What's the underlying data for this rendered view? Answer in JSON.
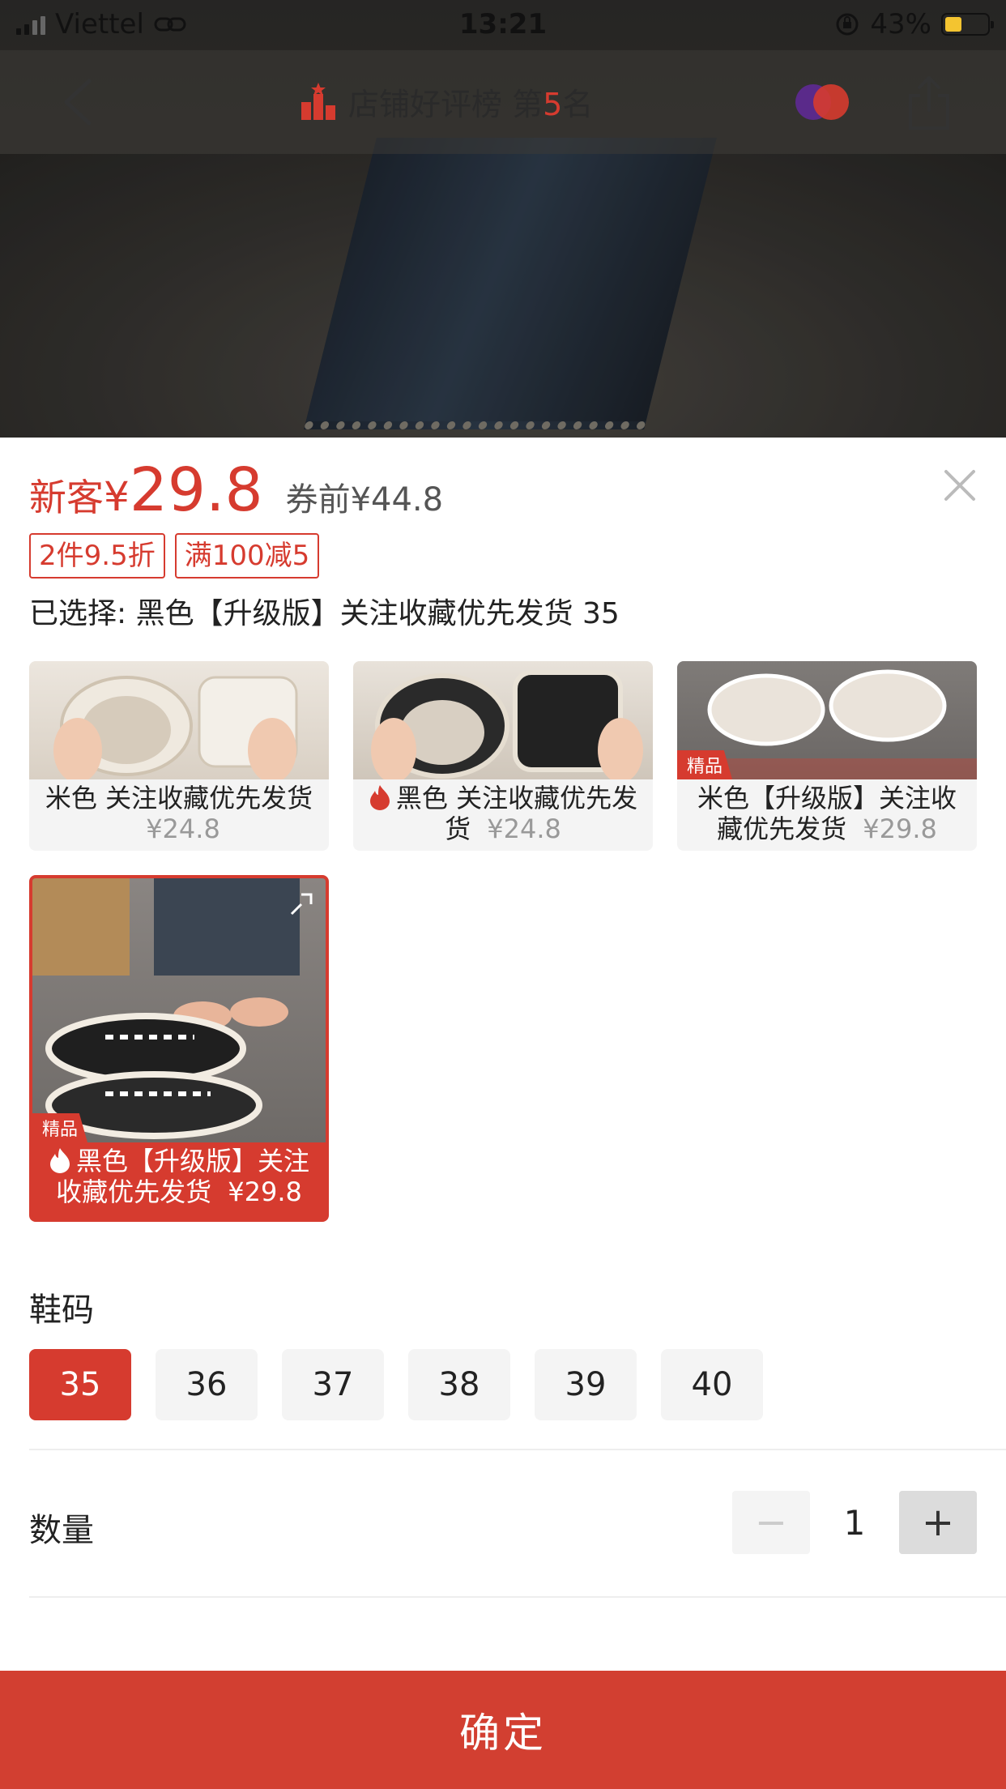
{
  "status_bar": {
    "carrier": "Viettel",
    "time": "13:21",
    "battery": "43%"
  },
  "nav": {
    "title_prefix": "店铺好评榜 第",
    "rank": "5",
    "title_suffix": "名"
  },
  "price": {
    "new_customer": "新客",
    "currency": "¥",
    "value": "29.8",
    "before_coupon": "券前¥44.8"
  },
  "promos": [
    "2件9.5折",
    "满100减5"
  ],
  "selected_text": "已选择: 黑色【升级版】关注收藏优先发货 35",
  "variants": [
    {
      "name": "米色 关注收藏优先发货",
      "price": "¥24.8",
      "hot": false,
      "badge": ""
    },
    {
      "name": "黑色 关注收藏优先发货",
      "price": "¥24.8",
      "hot": true,
      "badge": ""
    },
    {
      "name": "米色【升级版】关注收藏优先发货",
      "price": "¥29.8",
      "hot": false,
      "badge": "精品"
    },
    {
      "name": "黑色【升级版】关注收藏优先发货",
      "price": "¥29.8",
      "hot": true,
      "badge": "精品",
      "selected": true
    }
  ],
  "size_section": {
    "title": "鞋码",
    "options": [
      "35",
      "36",
      "37",
      "38",
      "39",
      "40"
    ],
    "selected": "35"
  },
  "quantity": {
    "label": "数量",
    "value": "1",
    "minus": "−",
    "plus": "+"
  },
  "confirm_label": "确定",
  "colors": {
    "accent": "#d63b2f",
    "chip_bg": "#f4f4f4"
  }
}
